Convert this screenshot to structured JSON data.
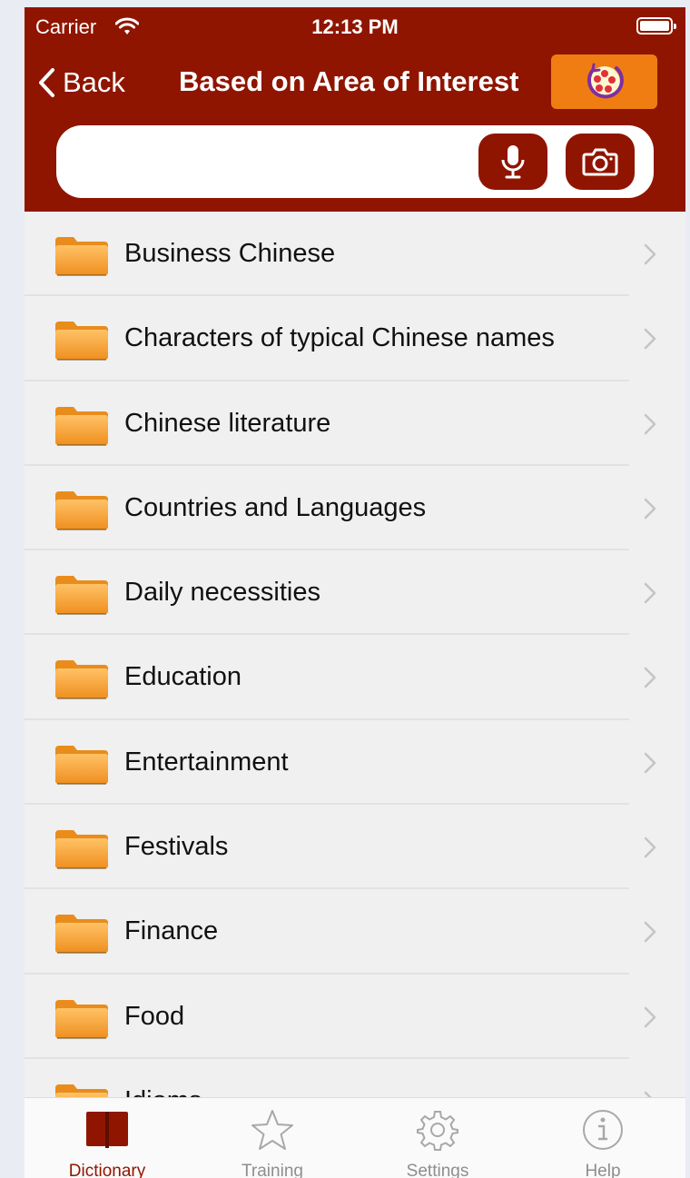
{
  "status_bar": {
    "carrier": "Carrier",
    "time": "12:13 PM"
  },
  "nav": {
    "back_label": "Back",
    "title": "Based on Area of Interest"
  },
  "search": {
    "placeholder": "",
    "value": ""
  },
  "list": {
    "items": [
      {
        "label": "Business Chinese"
      },
      {
        "label": "Characters of typical Chinese names"
      },
      {
        "label": "Chinese literature"
      },
      {
        "label": "Countries and Languages"
      },
      {
        "label": "Daily necessities"
      },
      {
        "label": "Education"
      },
      {
        "label": "Entertainment"
      },
      {
        "label": "Festivals"
      },
      {
        "label": "Finance"
      },
      {
        "label": "Food"
      },
      {
        "label": "Idioms"
      }
    ]
  },
  "tabbar": {
    "tabs": [
      {
        "label": "Dictionary",
        "icon": "book-icon",
        "active": true
      },
      {
        "label": "Training",
        "icon": "star-icon",
        "active": false
      },
      {
        "label": "Settings",
        "icon": "gear-icon",
        "active": false
      },
      {
        "label": "Help",
        "icon": "info-icon",
        "active": false
      }
    ]
  },
  "colors": {
    "brand": "#8f1500",
    "accent": "#f07d12",
    "folder": "#f5a233",
    "list_background": "#f0f0f0",
    "page_background": "#e9ecf2"
  }
}
